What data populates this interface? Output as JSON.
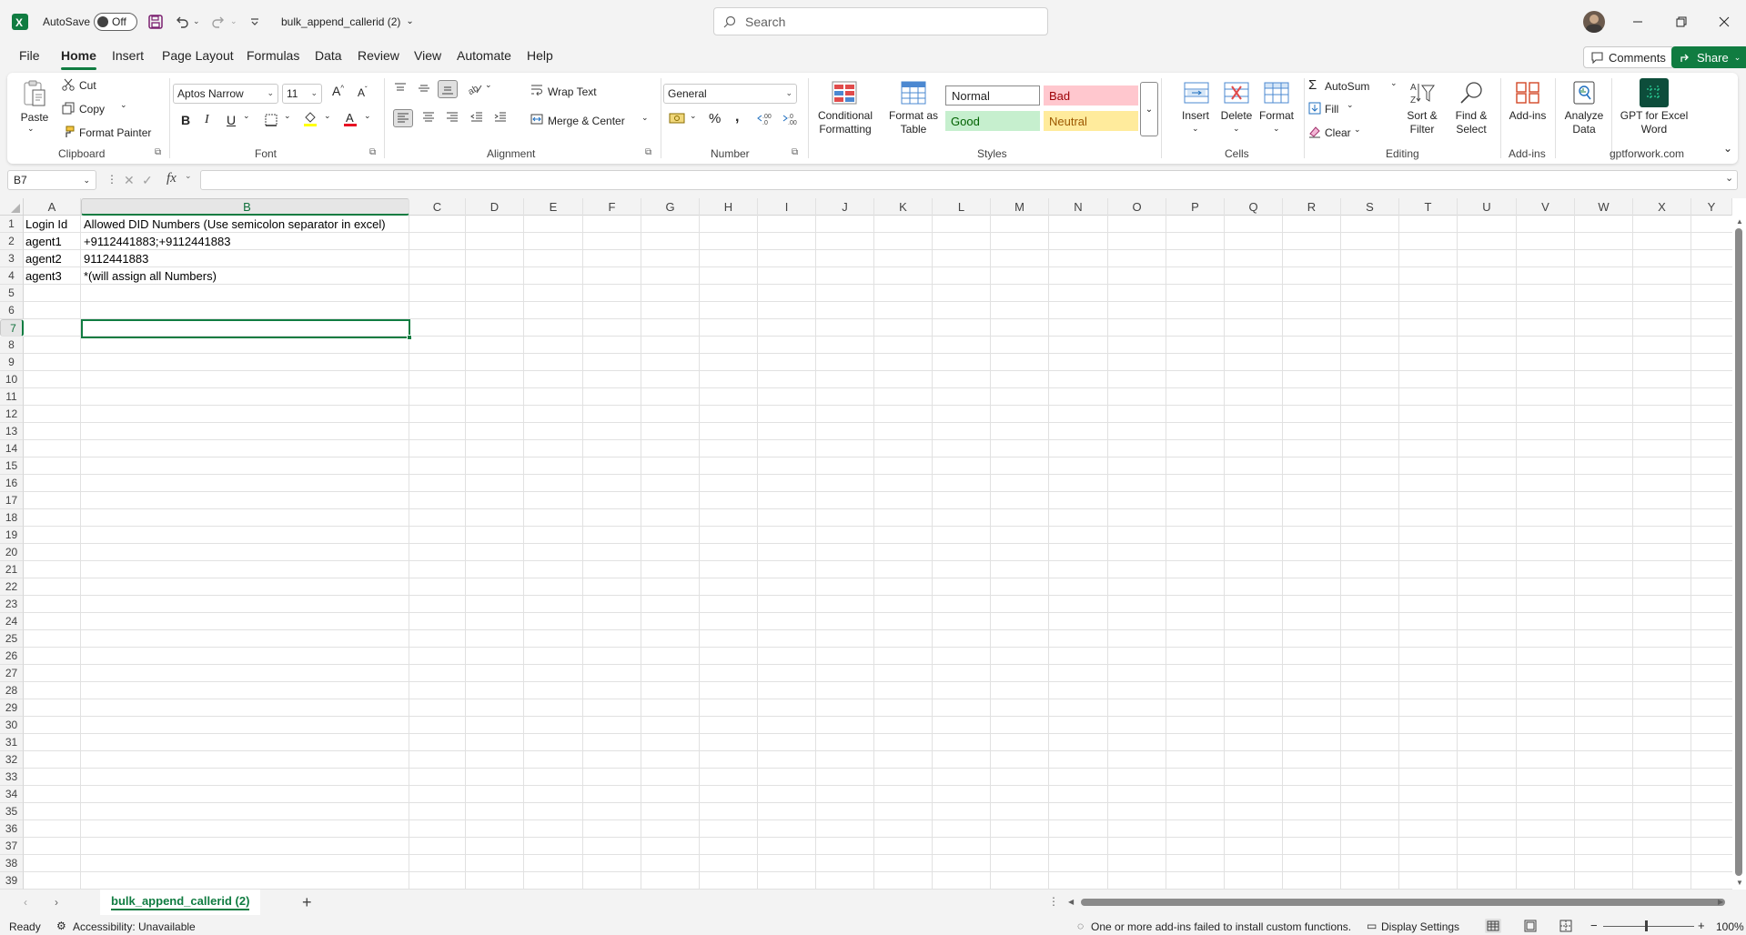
{
  "titlebar": {
    "autosave_label": "AutoSave",
    "autosave_state": "Off",
    "filename": "bulk_append_callerid (2)",
    "search_placeholder": "Search"
  },
  "menu": {
    "tabs": [
      "File",
      "Home",
      "Insert",
      "Page Layout",
      "Formulas",
      "Data",
      "Review",
      "View",
      "Automate",
      "Help"
    ],
    "active": "Home",
    "comments_label": "Comments",
    "share_label": "Share"
  },
  "ribbon": {
    "clipboard": {
      "paste": "Paste",
      "cut": "Cut",
      "copy": "Copy",
      "format_painter": "Format Painter",
      "label": "Clipboard"
    },
    "font": {
      "family": "Aptos Narrow",
      "size": "11",
      "label": "Font",
      "bold": "B",
      "italic": "I",
      "underline": "U"
    },
    "alignment": {
      "wrap_text": "Wrap Text",
      "merge_center": "Merge & Center",
      "label": "Alignment"
    },
    "number": {
      "format": "General",
      "label": "Number"
    },
    "styles": {
      "conditional_formatting": "Conditional Formatting",
      "format_as_table": "Format as Table",
      "normal": "Normal",
      "bad": "Bad",
      "good": "Good",
      "neutral": "Neutral",
      "label": "Styles"
    },
    "cells": {
      "insert": "Insert",
      "delete": "Delete",
      "format": "Format",
      "label": "Cells"
    },
    "editing": {
      "autosum": "AutoSum",
      "fill": "Fill",
      "clear": "Clear",
      "sort_filter": "Sort & Filter",
      "find_select": "Find & Select",
      "label": "Editing"
    },
    "addins": {
      "addins": "Add-ins",
      "label": "Add-ins"
    },
    "analyze": {
      "analyze_data": "Analyze Data"
    },
    "gpt": {
      "name": "GPT for Excel Word",
      "label": "gptforwork.com"
    }
  },
  "formula_bar": {
    "name_box": "B7",
    "fx": "fx",
    "formula": ""
  },
  "grid": {
    "columns": [
      "A",
      "B",
      "C",
      "D",
      "E",
      "F",
      "G",
      "H",
      "I",
      "J",
      "K",
      "L",
      "M",
      "N",
      "O",
      "P",
      "Q",
      "R",
      "S",
      "T",
      "U",
      "V",
      "W",
      "X",
      "Y"
    ],
    "rows": [
      "1",
      "2",
      "3",
      "4",
      "5",
      "6",
      "7",
      "8",
      "9",
      "10",
      "11",
      "12",
      "13",
      "14",
      "15",
      "16",
      "17",
      "18",
      "19",
      "20",
      "21",
      "22",
      "23",
      "24",
      "25",
      "26",
      "27",
      "28",
      "29",
      "30",
      "31",
      "32",
      "33",
      "34",
      "35",
      "36",
      "37",
      "38",
      "39"
    ],
    "selected_cell": "B7",
    "cells": {
      "A1": "Login Id",
      "B1": "Allowed DID Numbers (Use semicolon separator in excel)",
      "A2": "agent1",
      "B2": "+9112441883;+9112441883",
      "A3": "agent2",
      "B3": "9112441883",
      "A4": "agent3",
      "B4": "*(will assign all Numbers)"
    }
  },
  "sheets": {
    "tabs": [
      "bulk_append_callerid (2)"
    ],
    "add_label": "+"
  },
  "status": {
    "ready": "Ready",
    "accessibility": "Accessibility: Unavailable",
    "addins_msg": "One or more add-ins failed to install custom functions.",
    "display_settings": "Display Settings",
    "zoom": "100%"
  },
  "colors": {
    "accent": "#107c41",
    "bad_bg": "#ffc7ce",
    "bad_fg": "#9c0006",
    "good_bg": "#c6efce",
    "good_fg": "#006100",
    "neutral_bg": "#ffeb9c",
    "neutral_fg": "#9c5700"
  }
}
